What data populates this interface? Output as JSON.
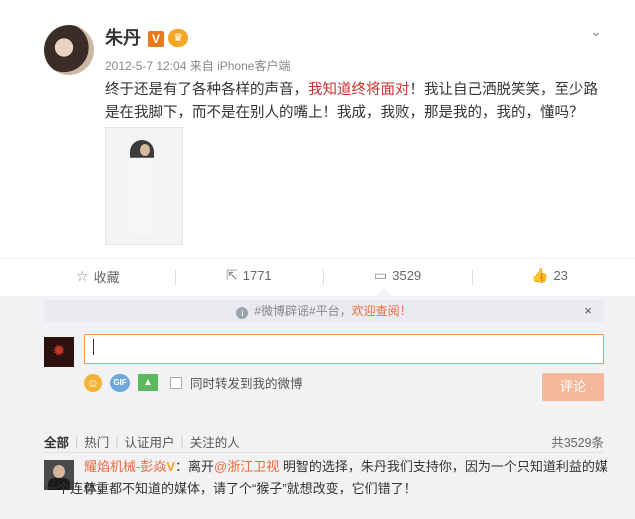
{
  "post": {
    "author": "朱丹",
    "v_badge": "V",
    "crown_badge": "♛",
    "timestamp": "2012-5-7 12:04",
    "source": "来自 iPhone客户端",
    "text_before": "终于还是有了各种各样的声音，",
    "text_highlight": "我知道终将面对",
    "text_after": "！我让自己洒脱笑笑，至少路是在我脚下，而不是在别人的嘴上！我成，我败，那是我的，我的，懂吗？"
  },
  "actions": {
    "favorite_label": "收藏",
    "repost_count": "1771",
    "comment_count": "3529",
    "like_count": "23"
  },
  "notice": {
    "prefix": "#微博辟谣#平台，",
    "accent": "欢迎查阅！",
    "close": "×"
  },
  "composer": {
    "input_value": "",
    "gif_label": "GIF",
    "repost_checkbox_label": "同时转发到我的微博",
    "submit_label": "评论"
  },
  "filters": {
    "items": [
      "全部",
      "热门",
      "认证用户",
      "关注的人"
    ],
    "total": "共3529条"
  },
  "comment": {
    "user": "耀焰机械-彭焱",
    "v_mark": "V",
    "colon": "：离开",
    "mention": "@浙江卫视",
    "line1_rest": " 明智的选择，朱丹我们支持你，因为一个只知道利益的媒体，",
    "line2": "一个连尊重都不知道的媒体，请了个“猴子”就想改变，它们错了！"
  },
  "colors": {
    "accent_orange": "#e86b3a",
    "highlight_red": "#c8302b",
    "panel_bg": "#f2f2f5"
  }
}
